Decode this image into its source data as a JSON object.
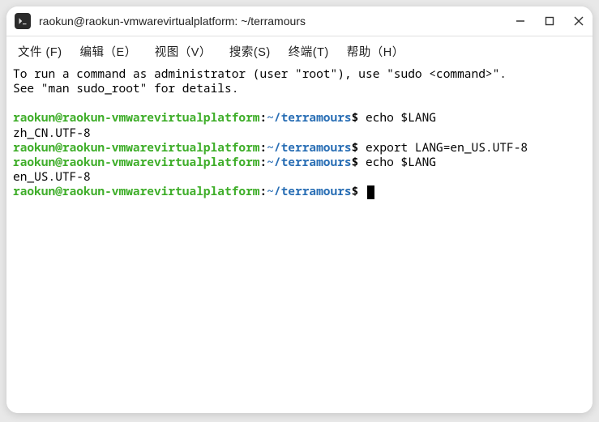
{
  "window": {
    "title": "raokun@raokun-vmwarevirtualplatform: ~/terramours"
  },
  "menubar": {
    "file": "文件 (F)",
    "edit": "编辑（E）",
    "view": "视图（V）",
    "search": "搜索(S)",
    "terminal": "终端(T)",
    "help": "帮助（H）"
  },
  "prompt": {
    "user": "raokun@raokun-vmwarevirtualplatform",
    "colon": ":",
    "path": "~/terramours",
    "dollar": "$"
  },
  "motd": {
    "line1": "To run a command as administrator (user \"root\"), use \"sudo <command>\".",
    "line2": "See \"man sudo_root\" for details."
  },
  "entries": [
    {
      "cmd": "echo $LANG",
      "out": "zh_CN.UTF-8"
    },
    {
      "cmd": "export LANG=en_US.UTF-8",
      "out": ""
    },
    {
      "cmd": "echo $LANG",
      "out": "en_US.UTF-8"
    }
  ]
}
